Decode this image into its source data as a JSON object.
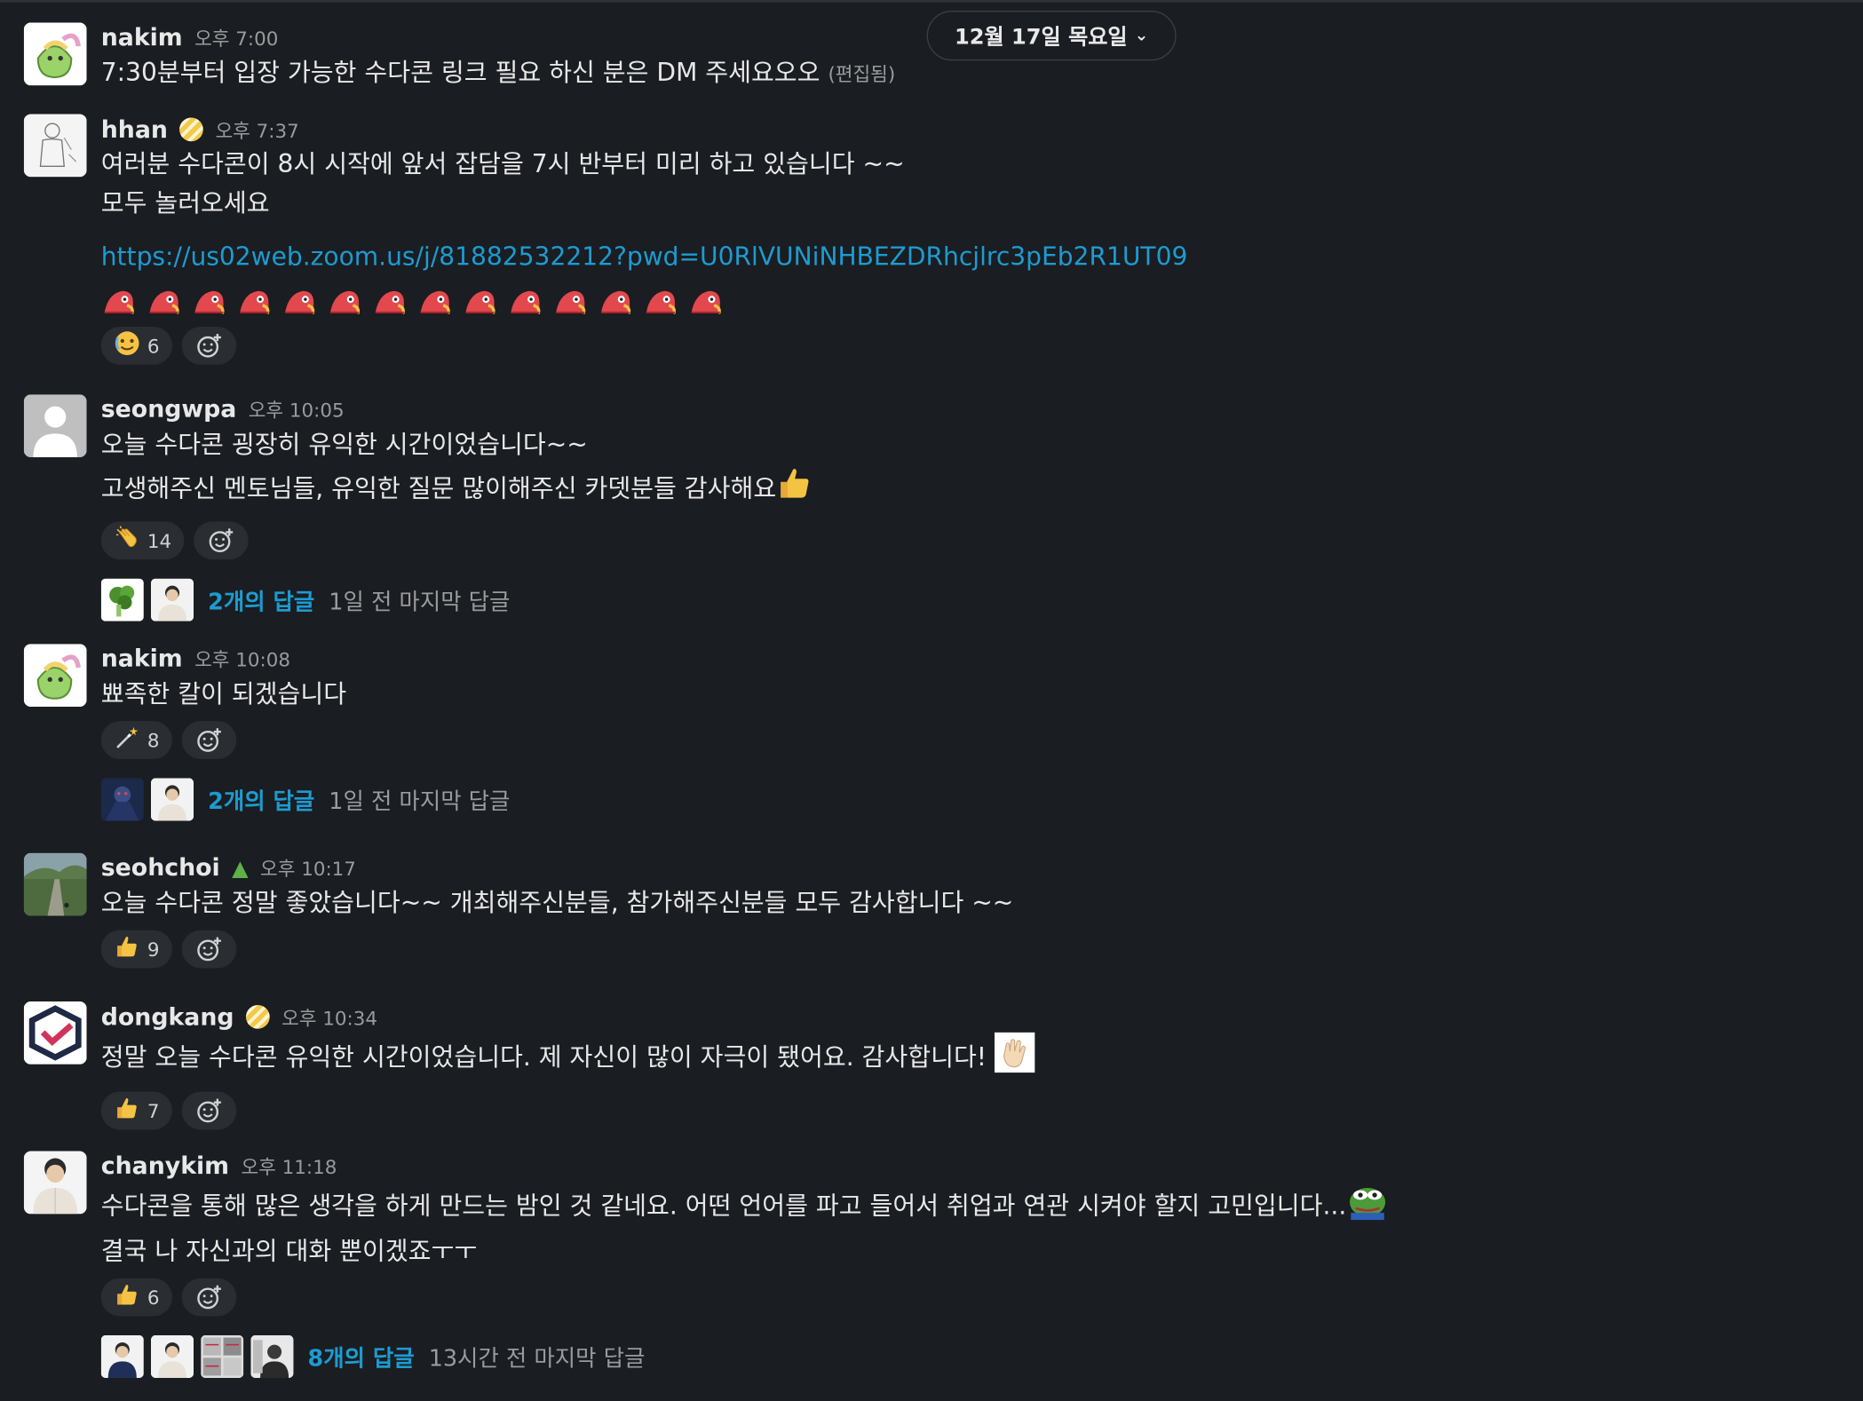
{
  "date_header": {
    "label": "12월 17일 목요일"
  },
  "messages": [
    {
      "name": "nakim",
      "time": "오후 7:00",
      "lines": [
        "7:30분부터 입장 가능한 수다콘 링크 필요 하신 분은 DM 주세요오오"
      ],
      "edited": "(편집됨)"
    },
    {
      "name": "hhan",
      "time": "오후 7:37",
      "lines": [
        "여러분 수다콘이 8시 시작에 앞서 잡담을 7시 반부터 미리 하고 있습니다 ~~",
        "모두 놀러오세요"
      ],
      "link": "https://us02web.zoom.us/j/81882532212?pwd=U0RlVUNiNHBEZDRhcjlrc3pEb2R1UT09",
      "reaction": {
        "icon": "crying-laugh-icon",
        "count": "6"
      }
    },
    {
      "name": "seongwpa",
      "time": "오후 10:05",
      "lines": [
        "오늘 수다콘 굉장히 유익한 시간이었습니다~~",
        "고생해주신 멘토님들, 유익한 질문 많이해주신 카뎃분들 감사해요"
      ],
      "reaction": {
        "icon": "clap-icon",
        "count": "14"
      },
      "thread": {
        "replies": "2개의 답글",
        "last": "1일 전 마지막 답글"
      }
    },
    {
      "name": "nakim",
      "time": "오후 10:08",
      "lines": [
        "뾰족한 칼이 되겠습니다"
      ],
      "reaction": {
        "icon": "magic-wand-icon",
        "count": "8"
      },
      "thread": {
        "replies": "2개의 답글",
        "last": "1일 전 마지막 답글"
      }
    },
    {
      "name": "seohchoi",
      "time": "오후 10:17",
      "lines": [
        "오늘 수다콘 정말 좋았습니다~~ 개최해주신분들, 참가해주신분들 모두 감사합니다 ~~"
      ],
      "reaction": {
        "icon": "thumbs-up-icon",
        "count": "9"
      }
    },
    {
      "name": "dongkang",
      "time": "오후 10:34",
      "lines": [
        "정말 오늘 수다콘 유익한 시간이었습니다. 제 자신이 많이 자극이 됐어요. 감사합니다!"
      ],
      "reaction": {
        "icon": "thumbs-up-icon",
        "count": "7"
      }
    },
    {
      "name": "chanykim",
      "time": "오후 11:18",
      "lines": [
        "수다콘을 통해 많은 생각을 하게 만드는 밤인 것 같네요. 어떤 언어를 파고 들어서 취업과 연관 시켜야 할지 고민입니다...",
        "결국 나 자신과의 대화 뿐이겠죠ㅜㅜ"
      ],
      "reaction": {
        "icon": "thumbs-up-icon",
        "count": "6"
      },
      "thread": {
        "replies": "8개의 답글",
        "last": "13시간 전 마지막 답글"
      }
    }
  ]
}
